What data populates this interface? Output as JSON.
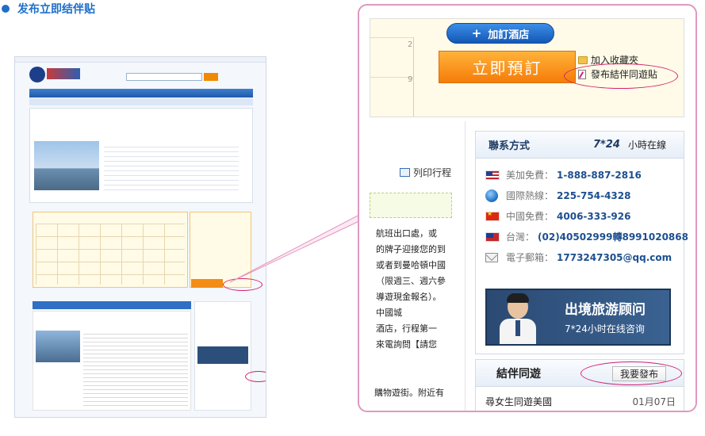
{
  "header": {
    "title": "发布立即结伴贴"
  },
  "hotel": {
    "add_hotel_label": "加訂酒店",
    "book_now_label": "立即預訂",
    "favorites_label": "加入收藏夾",
    "post_companion_label": "發布結伴同遊貼",
    "grid_numbers": [
      "2",
      "9"
    ]
  },
  "itinerary": {
    "print_label": "列印行程",
    "text_lines": [
      "航班出口處，或",
      "的牌子迎接您的到",
      "或者到曼哈頓中國",
      "（限週三、週六參",
      "導遊現金報名）。",
      "中國城",
      "酒店，行程第一",
      "來電詢問【請您"
    ],
    "bottom_text": "購物遊街。附近有"
  },
  "contact": {
    "title": "聯系方式",
    "hours_bold": "7*24",
    "hours_text": "小時在線",
    "rows": [
      {
        "icon": "us-flag-icon",
        "label": "美加免費：",
        "value": "1-888-887-2816"
      },
      {
        "icon": "globe-icon",
        "label": "國際熱線：",
        "value": "225-754-4328"
      },
      {
        "icon": "china-flag-icon",
        "label": "中國免費：",
        "value": "4006-333-926"
      },
      {
        "icon": "taiwan-flag-icon",
        "label": "台灣：",
        "value": "(02)40502999轉8991020868"
      },
      {
        "icon": "mail-icon",
        "label": "電子郵箱：",
        "value": "1773247305@qq.com"
      }
    ],
    "advisor_title": "出境旅游顾问",
    "advisor_sub": "7*24小时在线咨询"
  },
  "travel": {
    "title": "結伴同遊",
    "post_button": "我要發布",
    "items": [
      {
        "title": "尋女生同遊美國",
        "date": "01月07日"
      }
    ]
  },
  "colors": {
    "accent": "#1f6fc8",
    "highlight": "#d3206e",
    "orange": "#f57d08"
  }
}
